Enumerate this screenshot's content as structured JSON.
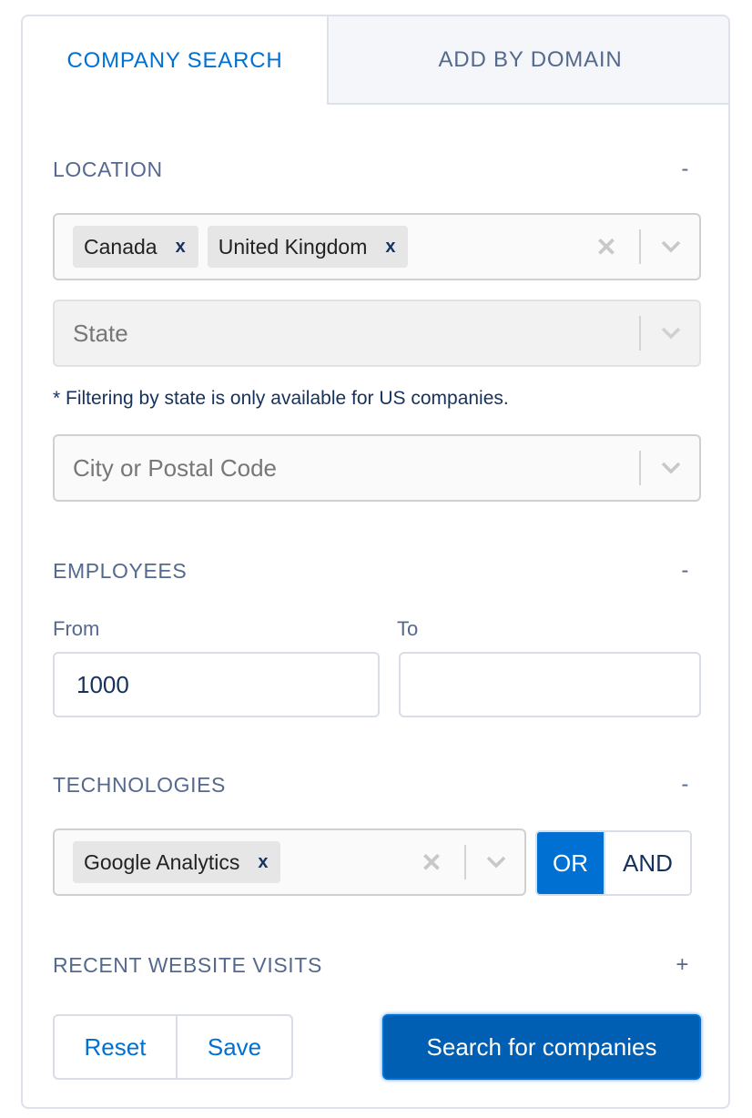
{
  "tabs": [
    {
      "label": "COMPANY SEARCH",
      "active": true
    },
    {
      "label": "ADD BY DOMAIN",
      "active": false
    }
  ],
  "location": {
    "heading": "LOCATION",
    "toggle": "-",
    "countries": [
      "Canada",
      "United Kingdom"
    ],
    "chip_remove": "x",
    "clear_icon": "✕",
    "state_placeholder": "State",
    "state_note": "* Filtering by state is only available for US companies.",
    "city_placeholder": "City or Postal Code"
  },
  "employees": {
    "heading": "EMPLOYEES",
    "toggle": "-",
    "from_label": "From",
    "from_value": "1000",
    "to_label": "To",
    "to_value": ""
  },
  "technologies": {
    "heading": "TECHNOLOGIES",
    "toggle": "-",
    "selected": [
      "Google Analytics"
    ],
    "chip_remove": "x",
    "clear_icon": "✕",
    "operator_or": "OR",
    "operator_and": "AND",
    "active_operator": "OR"
  },
  "recent_visits": {
    "heading": "RECENT WEBSITE VISITS",
    "toggle": "+"
  },
  "actions": {
    "reset": "Reset",
    "save": "Save",
    "search": "Search for companies"
  },
  "colors": {
    "accent": "#0070d2",
    "primary_button": "#005fb2",
    "heading_text": "#54698d",
    "dark_text": "#16325c"
  }
}
